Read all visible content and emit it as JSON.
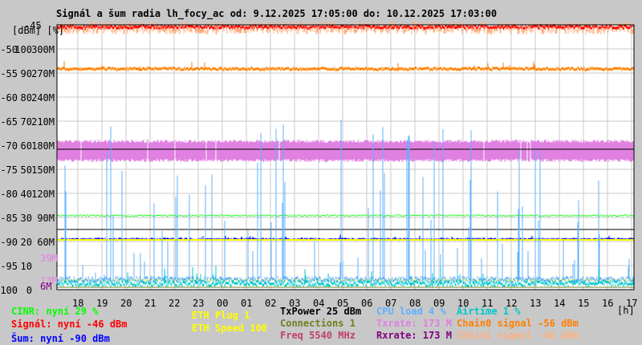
{
  "title": "Signál a šum radia lh_focy_ac od: 9.12.2025 17:05:00 do: 10.12.2025 17:03:00",
  "axis_header": "[dBm] [%]",
  "axis_top": "-45",
  "axis_rows": [
    {
      "dbm": "-50",
      "pct": "100",
      "rate": "300M"
    },
    {
      "dbm": "-55",
      "pct": "90",
      "rate": "270M"
    },
    {
      "dbm": "-60",
      "pct": "80",
      "rate": "240M"
    },
    {
      "dbm": "-65",
      "pct": "70",
      "rate": "210M"
    },
    {
      "dbm": "-70",
      "pct": "60",
      "rate": "180M"
    },
    {
      "dbm": "-75",
      "pct": "50",
      "rate": "150M"
    },
    {
      "dbm": "-80",
      "pct": "40",
      "rate": "120M"
    },
    {
      "dbm": "-85",
      "pct": "30",
      "rate": "90M"
    },
    {
      "dbm": "-90",
      "pct": "20",
      "rate": "60M"
    },
    {
      "dbm": "-95",
      "pct": "10",
      "rate": ""
    },
    {
      "dbm": "-100",
      "pct": "0",
      "rate": ""
    }
  ],
  "extra_labels": {
    "tx_max": "39M",
    "tx_min": "13M",
    "rx_min": "6M"
  },
  "unit_label": "[h]",
  "legend": {
    "cinr": "CINR: nyní 29 %",
    "signal": "Signál: nyní -46 dBm",
    "noise": "Šum: nyní -90 dBm",
    "eth_plug": "ETH Plug 1",
    "eth_speed": "ETH Speed 100",
    "txpower": "TxPower 25 dBm",
    "connections": "Connections 1",
    "freq": "Freq 5540 MHz",
    "cpu": "CPU load 4 %",
    "txrate": "Txrate: 173 M",
    "rxrate": "Rxrate: 173 M",
    "airtime": "Airtime 1 %",
    "chain0": "Chain0 signal -56 dBm",
    "chain1": "Chain1 signal -46 dBm"
  },
  "colors": {
    "signal": "#ff0000",
    "chain1": "#ffb080",
    "chain0": "#ff8000",
    "txrate": "#e080e0",
    "cinr": "#00ff00",
    "noise": "#0000ff",
    "eth": "#ffff00",
    "cpu": "#60b0ff",
    "airtime": "#00c8c8",
    "connections": "#708020",
    "freq": "#c04070",
    "rxrate": "#800080"
  },
  "chart_data": {
    "type": "line",
    "title": "Signál a šum radia lh_focy_ac od: 9.12.2025 17:05:00 do: 10.12.2025 17:03:00",
    "xlabel": "[h]",
    "ylabel": "[dBm] [%]",
    "ylim": [
      -100,
      -45
    ],
    "x_ticks": [
      "18",
      "19",
      "20",
      "21",
      "22",
      "23",
      "00",
      "01",
      "02",
      "03",
      "04",
      "05",
      "06",
      "07",
      "08",
      "09",
      "10",
      "11",
      "12",
      "13",
      "14",
      "15",
      "16",
      "17"
    ],
    "grid": true,
    "legend_placement": "bottom",
    "series": [
      {
        "name": "Chain1 signal",
        "unit": "dBm",
        "level": -46,
        "noise": 2
      },
      {
        "name": "Signál",
        "unit": "dBm",
        "level": -45.5,
        "noise": 1
      },
      {
        "name": "Chain0 signal",
        "unit": "dBm",
        "level": -54.5,
        "noise": 1
      },
      {
        "name": "Txrate",
        "unit": "M",
        "level": 165,
        "noise": 14
      },
      {
        "name": "CINR",
        "unit": "%",
        "level": 29,
        "noise": 1
      },
      {
        "name": "Šum",
        "unit": "dBm",
        "level": -89.5,
        "noise": 1
      },
      {
        "name": "ETH Speed",
        "unit": "",
        "level": -90,
        "noise": 0
      },
      {
        "name": "CPU load",
        "unit": "%",
        "level": 3,
        "noise": 25
      },
      {
        "name": "Airtime",
        "unit": "%",
        "level": 1,
        "noise": 4
      },
      {
        "name": "Connections",
        "unit": "",
        "level": -99.5,
        "noise": 0
      }
    ]
  }
}
